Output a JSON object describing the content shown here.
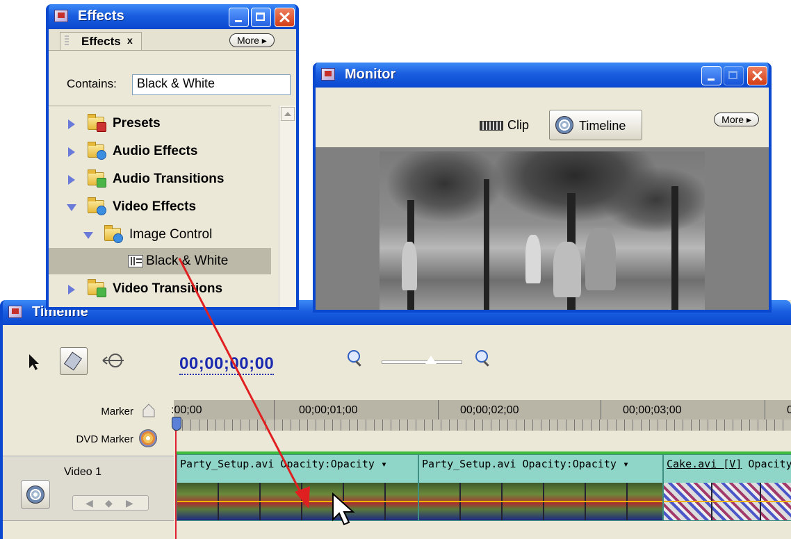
{
  "effects_window": {
    "title": "Effects",
    "tab_label": "Effects",
    "tab_close": "x",
    "more_label": "More ▸",
    "contains_label": "Contains:",
    "search_value": "Black & White",
    "tree": [
      {
        "label": "Presets",
        "bold": true
      },
      {
        "label": "Audio Effects",
        "bold": true
      },
      {
        "label": "Audio Transitions",
        "bold": true
      },
      {
        "label": "Video Effects",
        "bold": true
      },
      {
        "label": "Image Control",
        "bold": false
      },
      {
        "label": "Black & White",
        "bold": false,
        "selected": true
      },
      {
        "label": "Video Transitions",
        "bold": true
      }
    ]
  },
  "monitor_window": {
    "title": "Monitor",
    "more_label": "More ▸",
    "clip_tab": "Clip",
    "timeline_tab": "Timeline"
  },
  "timeline_window": {
    "title": "Timeline",
    "timecode": "00;00;00;00",
    "marker_label": "Marker",
    "dvd_marker_label": "DVD Marker",
    "ruler_ticks": [
      ":00;00",
      "00;00;01;00",
      "00;00;02;00",
      "00;00;03;00",
      "0"
    ],
    "track_name": "Video 1",
    "clips": [
      {
        "name": "Party_Setup.avi",
        "effect": "Opacity:Opacity ▾"
      },
      {
        "name": "Party_Setup.avi",
        "effect": "Opacity:Opacity ▾"
      },
      {
        "name": "Cake.avi [V]",
        "effect": "Opacity"
      }
    ]
  },
  "colors": {
    "xp_title_blue": "#0a48cf",
    "panel_bg": "#ece8d8",
    "timecode_blue": "#1a2ab0",
    "clip_teal": "#8fd5c8",
    "drag_arrow_red": "#e02020"
  }
}
